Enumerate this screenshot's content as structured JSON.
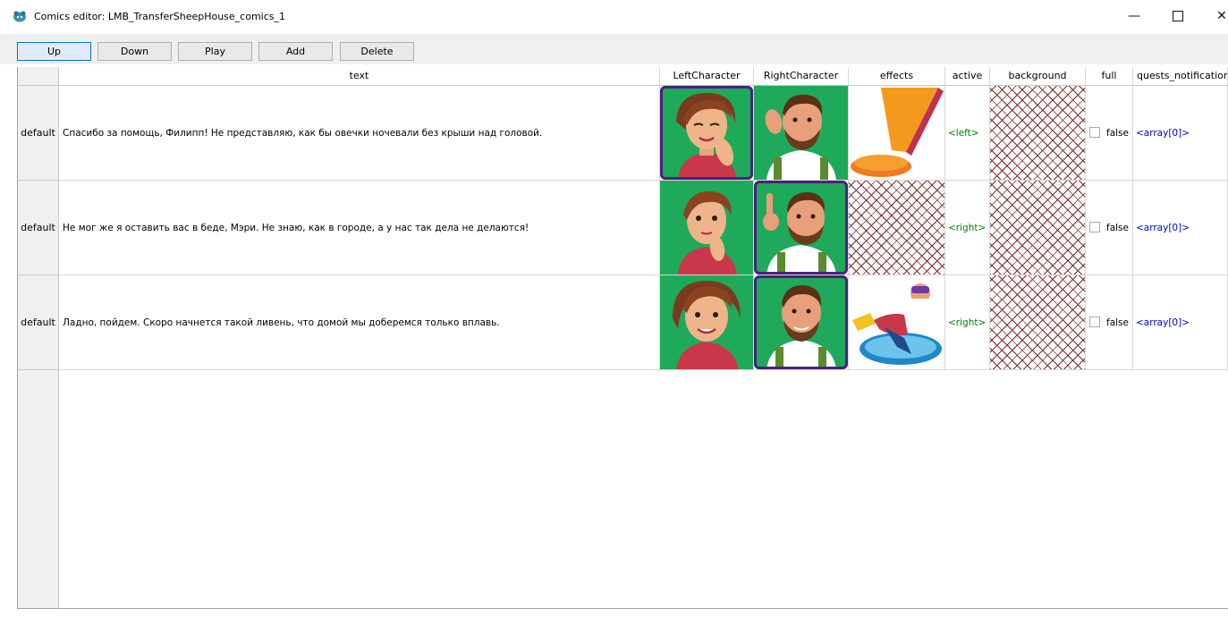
{
  "window": {
    "title": "Comics editor: LMB_TransferSheepHouse_comics_1",
    "minimize": "—",
    "close": "✕"
  },
  "toolbar": {
    "up": "Up",
    "down": "Down",
    "play": "Play",
    "add": "Add",
    "delete": "Delete"
  },
  "table": {
    "columns": [
      "text",
      "LeftCharacter",
      "RightCharacter",
      "effects",
      "active",
      "background",
      "full",
      "quests_notification"
    ],
    "rows": [
      {
        "header": "default",
        "text": "Спасибо за помощь, Филипп! Не представляю, как бы овечки ночевали без крыши над головой.",
        "left_character": "woman-smiling-eyes-closed",
        "right_character": "man-scratching-head",
        "effects": "exclamation-mark",
        "active": "<left>",
        "full": "false",
        "quests_notification": "<array[0]>"
      },
      {
        "header": "default",
        "text": "Не мог же я оставить вас в беде, Мэри. Не знаю, как в городе, а у нас так дела не делаются!",
        "left_character": "woman-thinking",
        "right_character": "man-pointing-up",
        "effects": "none",
        "active": "<right>",
        "full": "false",
        "quests_notification": "<array[0]>"
      },
      {
        "header": "default",
        "text": "Ладно, пойдем. Скоро начнется такой ливень, что домой мы доберемся только вплавь.",
        "left_character": "woman-smiling",
        "right_character": "man-smiling",
        "effects": "swimmer-diving",
        "active": "<right>",
        "full": "false",
        "quests_notification": "<array[0]>"
      }
    ]
  },
  "colors": {
    "portrait_background": "#1eaa5a",
    "selection_frame": "#4b2080",
    "active_text": "#008000",
    "array_text": "#0000cc",
    "hatch": "#7a2a2a"
  }
}
